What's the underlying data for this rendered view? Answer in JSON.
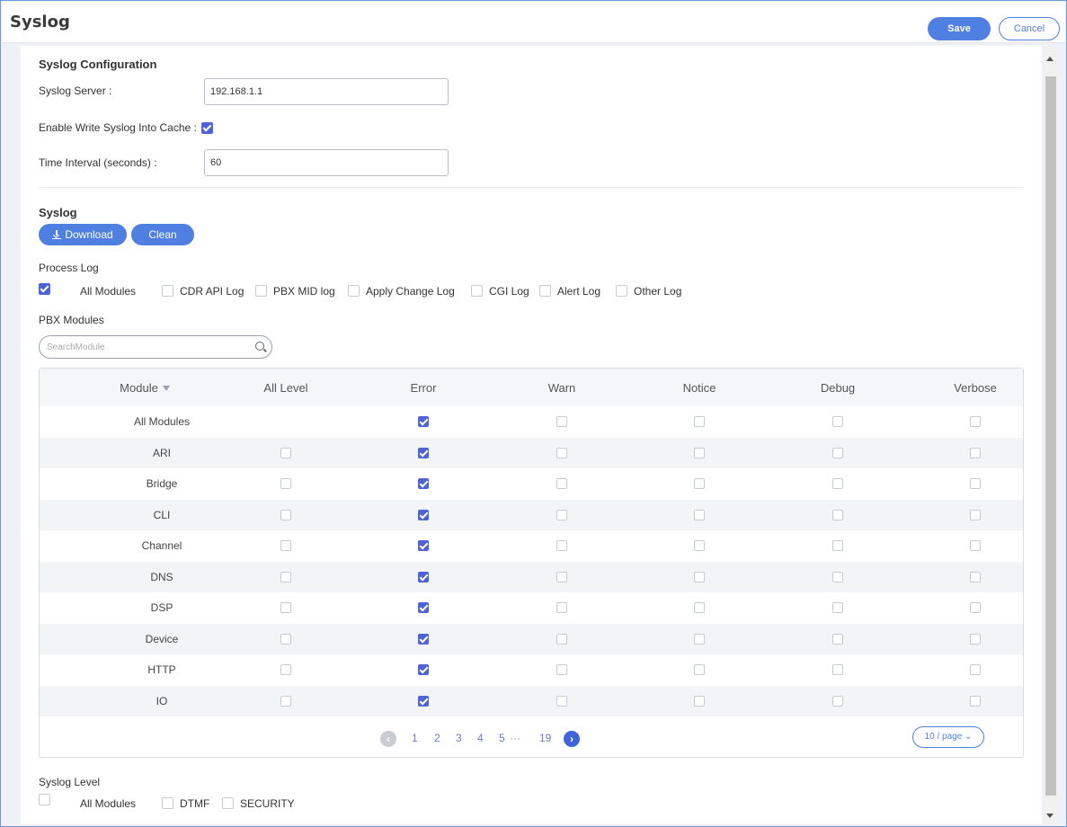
{
  "header": {
    "title": "Syslog",
    "save_label": "Save",
    "cancel_label": "Cancel"
  },
  "config": {
    "section_title": "Syslog Configuration",
    "server_label": "Syslog Server :",
    "server_value": "192.168.1.1",
    "cache_label": "Enable Write Syslog Into Cache :",
    "cache_checked": true,
    "interval_label": "Time Interval (seconds) :",
    "interval_value": "60"
  },
  "syslog": {
    "section_title": "Syslog",
    "download_label": "Download",
    "clean_label": "Clean",
    "process_log_label": "Process Log",
    "process_options": [
      {
        "label": "All Modules",
        "checked": true
      },
      {
        "label": "CDR API Log",
        "checked": false
      },
      {
        "label": "PBX MID log",
        "checked": false
      },
      {
        "label": "Apply Change Log",
        "checked": false
      },
      {
        "label": "CGI Log",
        "checked": false
      },
      {
        "label": "Alert Log",
        "checked": false
      },
      {
        "label": "Other Log",
        "checked": false
      }
    ],
    "pbx_modules_label": "PBX Modules",
    "search_placeholder": "SearchModule"
  },
  "table": {
    "columns": [
      "Module",
      "All Level",
      "Error",
      "Warn",
      "Notice",
      "Debug",
      "Verbose"
    ],
    "rows": [
      {
        "name": "All Modules",
        "all_level": null,
        "error": true,
        "warn": false,
        "notice": false,
        "debug": false,
        "verbose": false
      },
      {
        "name": "ARI",
        "all_level": false,
        "error": true,
        "warn": false,
        "notice": false,
        "debug": false,
        "verbose": false
      },
      {
        "name": "Bridge",
        "all_level": false,
        "error": true,
        "warn": false,
        "notice": false,
        "debug": false,
        "verbose": false
      },
      {
        "name": "CLI",
        "all_level": false,
        "error": true,
        "warn": false,
        "notice": false,
        "debug": false,
        "verbose": false
      },
      {
        "name": "Channel",
        "all_level": false,
        "error": true,
        "warn": false,
        "notice": false,
        "debug": false,
        "verbose": false
      },
      {
        "name": "DNS",
        "all_level": false,
        "error": true,
        "warn": false,
        "notice": false,
        "debug": false,
        "verbose": false
      },
      {
        "name": "DSP",
        "all_level": false,
        "error": true,
        "warn": false,
        "notice": false,
        "debug": false,
        "verbose": false
      },
      {
        "name": "Device",
        "all_level": false,
        "error": true,
        "warn": false,
        "notice": false,
        "debug": false,
        "verbose": false
      },
      {
        "name": "HTTP",
        "all_level": false,
        "error": true,
        "warn": false,
        "notice": false,
        "debug": false,
        "verbose": false
      },
      {
        "name": "IO",
        "all_level": false,
        "error": true,
        "warn": false,
        "notice": false,
        "debug": false,
        "verbose": false
      }
    ]
  },
  "pagination": {
    "pages": [
      "1",
      "2",
      "3",
      "4",
      "5"
    ],
    "ellipsis": "···",
    "last_page": "19",
    "current_page": "1",
    "page_size_label": "10 / page"
  },
  "syslog_level": {
    "label": "Syslog Level",
    "options": [
      {
        "label": "All Modules",
        "checked": false
      },
      {
        "label": "DTMF",
        "checked": false
      },
      {
        "label": "SECURITY",
        "checked": false
      }
    ]
  },
  "colors": {
    "accent": "#4f7fe0",
    "checkbox_on": "#4f63d8",
    "frame_border": "#6f9ad9"
  },
  "icons": [
    "download-icon",
    "search-icon",
    "filter-icon",
    "chevron-left-icon",
    "chevron-right-icon",
    "chevron-down-icon"
  ]
}
